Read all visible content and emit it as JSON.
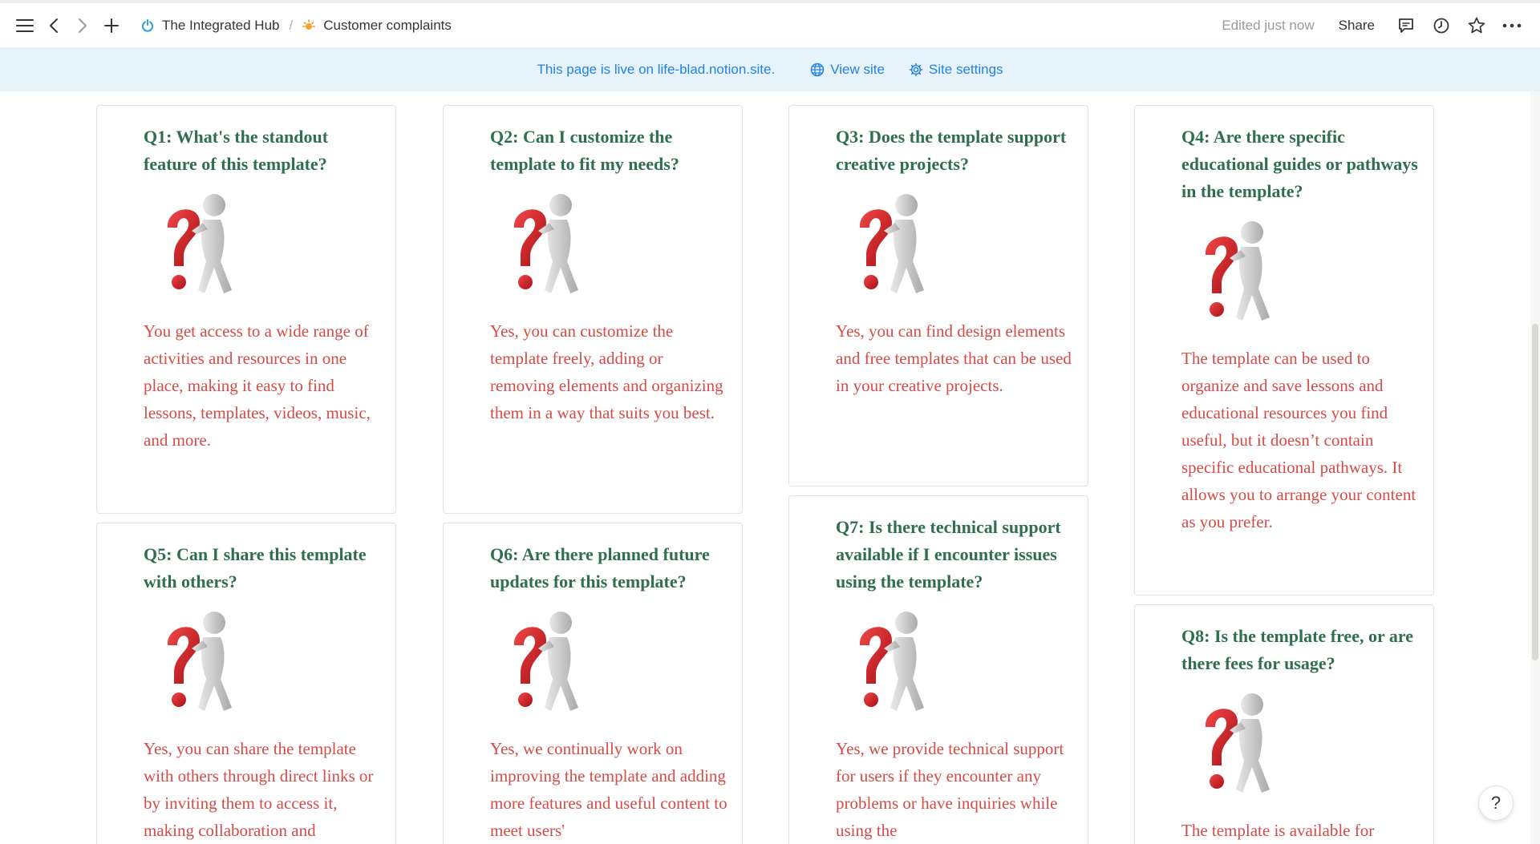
{
  "topbar": {
    "breadcrumb": [
      {
        "label": "The Integrated Hub",
        "icon": "power-icon"
      },
      {
        "label": "Customer complaints",
        "icon": "sun-emoji-icon"
      }
    ],
    "separator": "/",
    "edited": "Edited just now",
    "share_label": "Share"
  },
  "banner": {
    "text": "This page is live on life-blad.notion.site.",
    "view_site": "View site",
    "site_settings": "Site settings"
  },
  "faq": [
    {
      "question": "Q1: What's the standout feature of this template?",
      "answer": "You get access to a wide range of activities and resources in one place, making it easy to find lessons, templates, videos, music, and more."
    },
    {
      "question": "Q2: Can I customize the template to fit my needs?",
      "answer": "Yes, you can customize the template freely, adding or removing elements and organizing them in a way that suits you best."
    },
    {
      "question": "Q3: Does the template support creative projects?",
      "answer": "Yes, you can find design elements and free templates that can be used in your creative projects."
    },
    {
      "question": "Q4: Are there specific educational guides or pathways in the template?",
      "answer": "The template can be used to organize and save lessons and educational resources you find useful, but it doesn’t contain specific educational pathways. It allows you to arrange your content as you prefer."
    },
    {
      "question": "Q5: Can I share this template with others?",
      "answer": "Yes, you can share the template with others through direct links or by inviting them to access it, making collaboration and"
    },
    {
      "question": "Q6: Are there planned future updates for this template?",
      "answer": "Yes, we continually work on improving the template and adding more features and useful content to meet users'"
    },
    {
      "question": "Q7: Is there technical support available if I encounter issues using the template?",
      "answer": "Yes, we provide technical support for users if they encounter any problems or have inquiries while using the"
    },
    {
      "question": "Q8: Is the template free, or are there fees for usage?",
      "answer": "The template is available for"
    }
  ],
  "help_label": "?",
  "colors": {
    "question": "#2f6f4e",
    "answer": "#d44c47",
    "banner_bg": "#e7f3fb",
    "link": "#2383e2"
  }
}
